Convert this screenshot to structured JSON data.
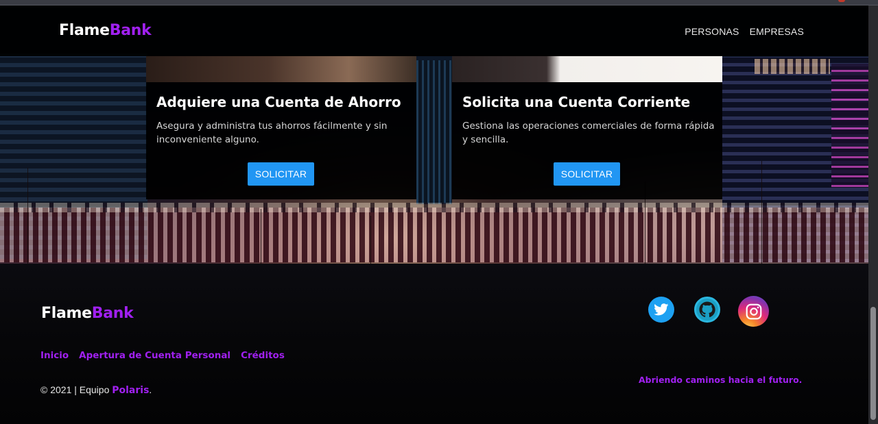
{
  "brand": {
    "part1": "Flame",
    "part2": "Bank"
  },
  "nav": {
    "items": [
      "PERSONAS",
      "EMPRESAS"
    ]
  },
  "cards": [
    {
      "title": "Adquiere una Cuenta de Ahorro",
      "text": "Asegura y administra tus ahorros fácilmente y sin inconveniente alguno.",
      "button": "SOLICITAR"
    },
    {
      "title": "Solicita una Cuenta Corriente",
      "text": "Gestiona las operaciones comerciales de forma rápida y sencilla.",
      "button": "SOLICITAR"
    }
  ],
  "footer": {
    "links": [
      "Inicio",
      "Apertura de Cuenta Personal",
      "Créditos"
    ],
    "copyright_prefix": "© 2021 | Equipo ",
    "team": "Polaris",
    "copyright_suffix": ".",
    "tagline": "Abriendo caminos hacia el futuro.",
    "social": [
      "twitter-icon",
      "github-icon",
      "instagram-icon"
    ]
  },
  "colors": {
    "accent": "#a020f0",
    "button": "#2196f3",
    "background": "#000000"
  }
}
